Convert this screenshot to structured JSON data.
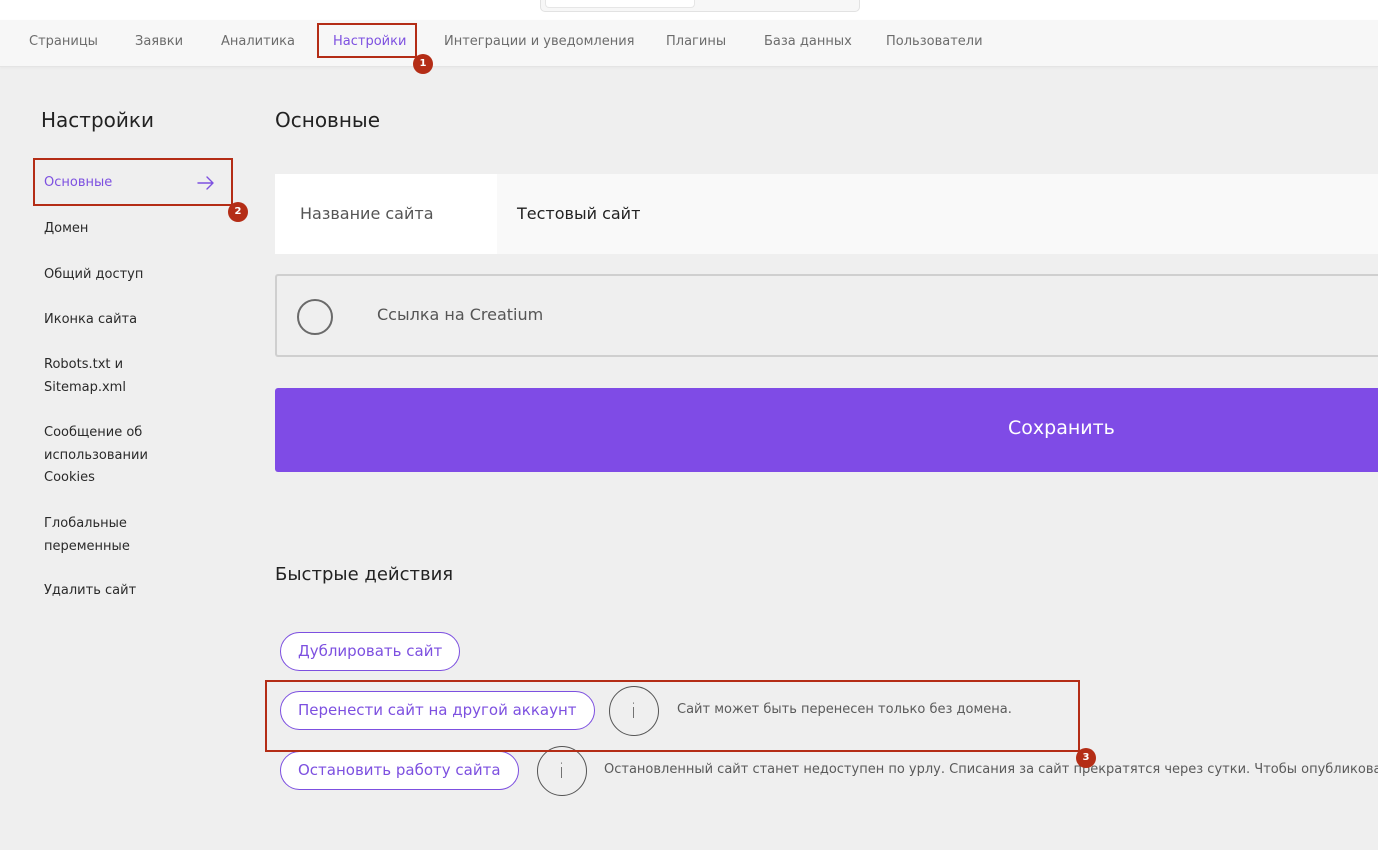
{
  "nav": {
    "items": [
      {
        "label": "Страницы"
      },
      {
        "label": "Заявки"
      },
      {
        "label": "Аналитика"
      },
      {
        "label": "Настройки",
        "active": true
      },
      {
        "label": "Интеграции и уведомления"
      },
      {
        "label": "Плагины"
      },
      {
        "label": "База данных"
      },
      {
        "label": "Пользователи"
      }
    ]
  },
  "sidebar": {
    "title": "Настройки",
    "items": [
      {
        "label": "Основные",
        "active": true
      },
      {
        "label": "Домен"
      },
      {
        "label": "Общий доступ"
      },
      {
        "label": "Иконка сайта"
      },
      {
        "label": "Robots.txt и Sitemap.xml"
      },
      {
        "label": "Сообщение об использовании Cookies"
      },
      {
        "label": "Глобальные переменные"
      },
      {
        "label": "Удалить сайт"
      }
    ]
  },
  "main": {
    "title": "Основные",
    "site_name_label": "Название сайта",
    "site_name_value": "Тестовый сайт",
    "creatium_link_label": "Ссылка на Creatium",
    "save_label": "Сохранить"
  },
  "quick": {
    "title": "Быстрые действия",
    "duplicate_label": "Дублировать сайт",
    "transfer_label": "Перенести сайт на другой аккаунт",
    "transfer_hint": "Сайт может быть перенесен только без домена.",
    "stop_label": "Остановить работу сайта",
    "stop_hint": "Остановленный сайт станет недоступен по урлу. Списания за сайт прекратятся через сутки. Чтобы опубликовать",
    "info_glyph": "i"
  },
  "annotations": {
    "badge1": "1",
    "badge2": "2",
    "badge3": "3"
  },
  "colors": {
    "accent": "#7f4be6",
    "annotation": "#b42d16",
    "background": "#efefef"
  }
}
